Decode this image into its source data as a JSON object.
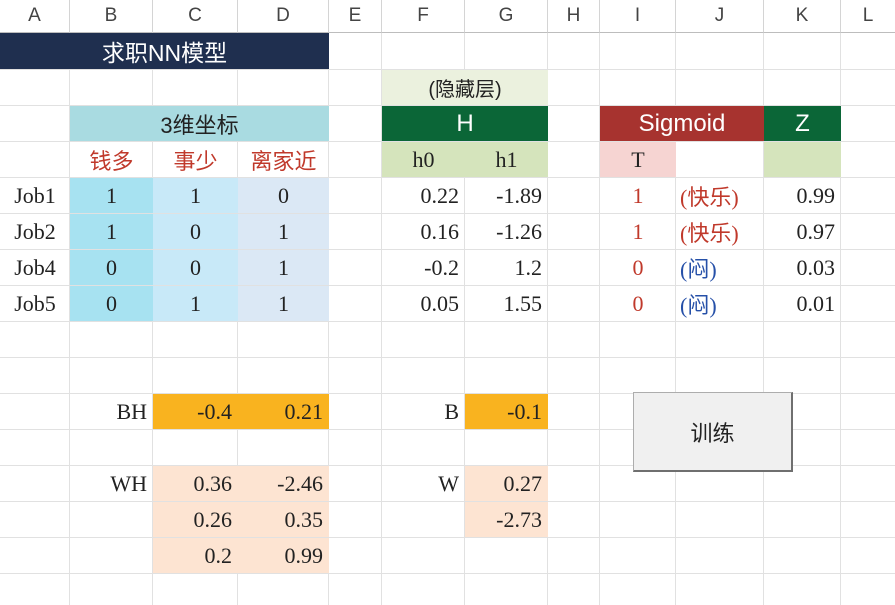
{
  "columns": [
    "A",
    "B",
    "C",
    "D",
    "E",
    "F",
    "G",
    "H",
    "I",
    "J",
    "K",
    "L"
  ],
  "colors": {
    "title_bg": "#1f2f4f",
    "input_header_bg": "#a9dbe1",
    "col_b_bg": "#a7e2f1",
    "col_c_bg": "#c8e9f8",
    "col_d_bg": "#dbe8f5",
    "hidden_label_bg": "#ebf1de",
    "hidden_header_bg": "#0b6637",
    "hidden_sub_bg": "#d5e4bc",
    "sigmoid_bg": "#a7332f",
    "t_bg": "#f6d4d2",
    "weight_bias_bg": "#f9b31f",
    "weight_bg": "#fde4d2",
    "red_text": "#c0392b",
    "blue_text": "#2650a8"
  },
  "title": "求职NN模型",
  "inputs": {
    "header": "3维坐标",
    "features": [
      "钱多",
      "事少",
      "离家近"
    ],
    "rows": [
      {
        "label": "Job1",
        "values": [
          "1",
          "1",
          "0"
        ]
      },
      {
        "label": "Job2",
        "values": [
          "1",
          "0",
          "1"
        ]
      },
      {
        "label": "Job4",
        "values": [
          "0",
          "0",
          "1"
        ]
      },
      {
        "label": "Job5",
        "values": [
          "0",
          "1",
          "1"
        ]
      }
    ]
  },
  "hidden": {
    "label": "(隐藏层)",
    "header": "H",
    "subs": [
      "h0",
      "h1"
    ],
    "rows": [
      [
        "0.22",
        "-1.89"
      ],
      [
        "0.16",
        "-1.26"
      ],
      [
        "-0.2",
        "1.2"
      ],
      [
        "0.05",
        "1.55"
      ]
    ]
  },
  "output": {
    "sigmoid_label": "Sigmoid",
    "z_label": "Z",
    "t_label": "T",
    "rows": [
      {
        "t": "1",
        "mood": "(快乐)",
        "z": "0.99"
      },
      {
        "t": "1",
        "mood": "(快乐)",
        "z": "0.97"
      },
      {
        "t": "0",
        "mood": "(闷)",
        "z": "0.03"
      },
      {
        "t": "0",
        "mood": "(闷)",
        "z": "0.01"
      }
    ]
  },
  "params": {
    "bh_label": "BH",
    "bh": [
      "-0.4",
      "0.21"
    ],
    "b_label": "B",
    "b": "-0.1",
    "wh_label": "WH",
    "wh": [
      [
        "0.36",
        "-2.46"
      ],
      [
        "0.26",
        "0.35"
      ],
      [
        "0.2",
        "0.99"
      ]
    ],
    "w_label": "W",
    "w": [
      "0.27",
      "-2.73"
    ]
  },
  "train_button": "训练"
}
